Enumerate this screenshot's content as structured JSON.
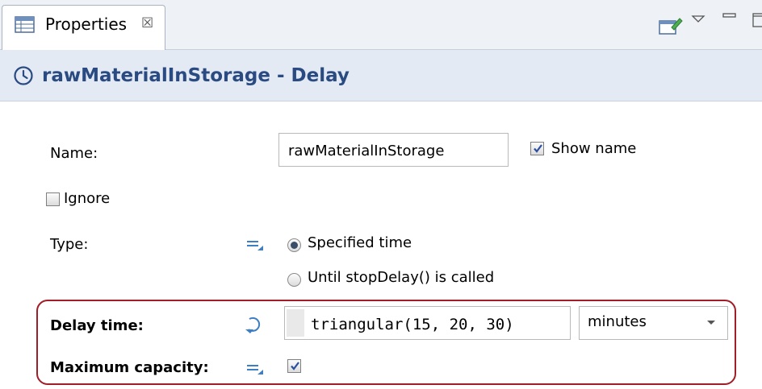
{
  "tab": {
    "label": "Properties",
    "close_glyph": "☒"
  },
  "header": {
    "title": "rawMaterialInStorage - Delay"
  },
  "form": {
    "name_label": "Name:",
    "name_value": "rawMaterialInStorage",
    "show_name_label": "Show name",
    "show_name_checked": true,
    "ignore_label": "Ignore",
    "ignore_checked": false,
    "type_label": "Type:",
    "type_options": [
      "Specified time",
      "Until stopDelay() is called"
    ],
    "type_selected": "Specified time",
    "delay_time_label": "Delay time:",
    "delay_time_value": "triangular(15, 20, 30)",
    "delay_unit": "minutes",
    "max_capacity_label": "Maximum capacity:",
    "max_capacity_checked": true
  },
  "icons": [
    "table-icon",
    "close-icon",
    "edit-icon",
    "view-menu-icon",
    "minimize-icon",
    "maximize-icon",
    "clock-icon",
    "static-value-icon",
    "dynamic-value-icon",
    "dropdown-arrow-icon"
  ],
  "colors": {
    "title": "#2a4a82",
    "highlight": "#a11d27",
    "header_bg": "#e3eaf4",
    "icon_blue": "#3c7fc4"
  }
}
